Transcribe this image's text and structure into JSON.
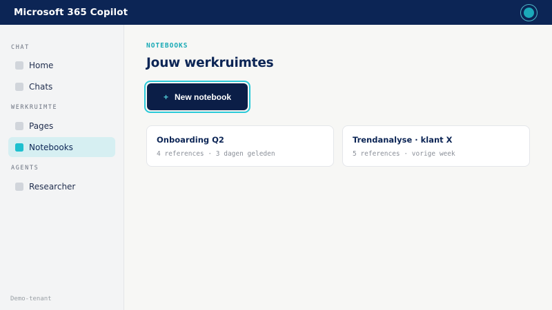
{
  "app": {
    "title": "Microsoft 365 Copilot"
  },
  "sidebar": {
    "sections": [
      {
        "label": "CHAT"
      },
      {
        "label": "WERKRUIMTE"
      },
      {
        "label": "AGENTS"
      }
    ],
    "items": [
      {
        "label": "Home",
        "icon": "square-icon"
      },
      {
        "label": "Chats",
        "icon": "square-icon"
      },
      {
        "label": "Pages",
        "icon": "square-icon"
      },
      {
        "label": "Notebooks",
        "icon": "square-icon",
        "active": true
      },
      {
        "label": "Researcher",
        "icon": "square-icon"
      }
    ],
    "tenant": "Demo-tenant"
  },
  "main": {
    "eyebrow": "NOTEBOOKS",
    "title": "Jouw werkruimtes",
    "new_button": {
      "icon": "+",
      "label": "New notebook"
    },
    "cards": [
      {
        "title": "Onboarding Q2",
        "meta": "4 references · 3 dagen geleden"
      },
      {
        "title": "Trendanalyse · klant X",
        "meta": "5 references · vorige week"
      }
    ]
  },
  "colors": {
    "topbar": "#0c2555",
    "accent": "#1ec0cf",
    "active_bg": "#d6eff2",
    "button_bg": "#0b1e47"
  }
}
